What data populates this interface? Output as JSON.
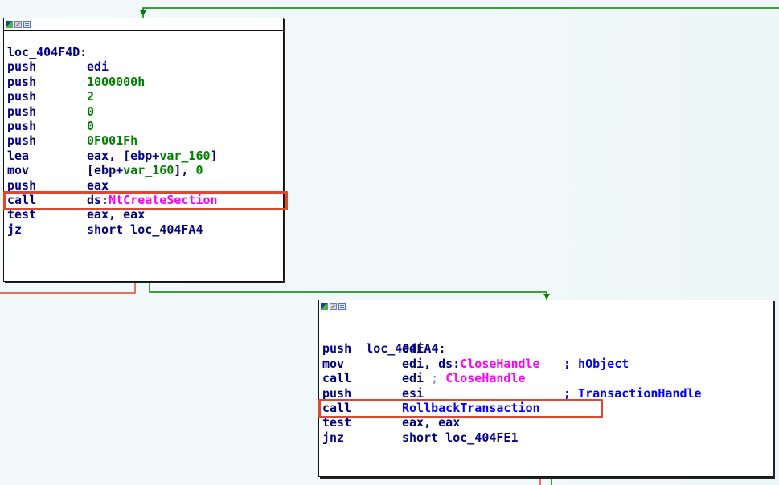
{
  "colors": {
    "background": "#f4fafb",
    "flow_true": "#008000",
    "flow_false": "#e0472f",
    "highlight": "#e0472f",
    "text_default": "#000080",
    "text_number": "#008000",
    "text_import": "#ff00ff",
    "text_comment": "#0000ff"
  },
  "node1": {
    "header_icons": [
      "graph-overview-icon",
      "edit-node-icon",
      "node-window-icon"
    ],
    "label": "loc_404F4D:",
    "lines": [
      {
        "mn": "push",
        "op": [
          {
            "t": "edi",
            "c": "op"
          }
        ]
      },
      {
        "mn": "push",
        "op": [
          {
            "t": "1000000h",
            "c": "num"
          }
        ]
      },
      {
        "mn": "push",
        "op": [
          {
            "t": "2",
            "c": "num"
          }
        ]
      },
      {
        "mn": "push",
        "op": [
          {
            "t": "0",
            "c": "num"
          }
        ]
      },
      {
        "mn": "push",
        "op": [
          {
            "t": "0",
            "c": "num"
          }
        ]
      },
      {
        "mn": "push",
        "op": [
          {
            "t": "0F001Fh",
            "c": "num"
          }
        ]
      },
      {
        "mn": "lea",
        "op": [
          {
            "t": "eax, [ebp+",
            "c": "op"
          },
          {
            "t": "var_160",
            "c": "var"
          },
          {
            "t": "]",
            "c": "op"
          }
        ]
      },
      {
        "mn": "mov",
        "op": [
          {
            "t": "[ebp+",
            "c": "op"
          },
          {
            "t": "var_160",
            "c": "var"
          },
          {
            "t": "], ",
            "c": "op"
          },
          {
            "t": "0",
            "c": "num"
          }
        ]
      },
      {
        "mn": "push",
        "op": [
          {
            "t": "eax",
            "c": "op"
          }
        ]
      },
      {
        "mn": "call",
        "op": [
          {
            "t": "ds:",
            "c": "op"
          },
          {
            "t": "NtCreateSection",
            "c": "imp"
          }
        ]
      },
      {
        "mn": "test",
        "op": [
          {
            "t": "eax, eax",
            "c": "op"
          }
        ]
      },
      {
        "mn": "jz",
        "op": [
          {
            "t": "short loc_404FA4",
            "c": "op"
          }
        ]
      }
    ],
    "highlighted_index": 9
  },
  "node2": {
    "header_icons": [
      "graph-overview-icon",
      "edit-node-icon",
      "node-window-icon"
    ],
    "label": "loc_404FA4:",
    "label_comment": "; hObject",
    "lines": [
      {
        "mn": "push",
        "op": [
          {
            "t": "edi",
            "c": "op"
          }
        ]
      },
      {
        "mn": "mov",
        "op": [
          {
            "t": "edi, ds:",
            "c": "op"
          },
          {
            "t": "CloseHandle",
            "c": "imp"
          }
        ]
      },
      {
        "mn": "call",
        "op": [
          {
            "t": "edi ",
            "c": "op"
          },
          {
            "t": "; ",
            "c": "sep"
          },
          {
            "t": "CloseHandle",
            "c": "imp"
          }
        ]
      },
      {
        "mn": "push",
        "op": [
          {
            "t": "esi",
            "c": "op"
          }
        ],
        "comment": "; TransactionHandle"
      },
      {
        "mn": "call",
        "op": [
          {
            "t": "RollbackTransaction",
            "c": "cmt"
          }
        ]
      },
      {
        "mn": "test",
        "op": [
          {
            "t": "eax, eax",
            "c": "op"
          }
        ]
      },
      {
        "mn": "jnz",
        "op": [
          {
            "t": "short loc_404FE1",
            "c": "op"
          }
        ]
      }
    ],
    "highlighted_index": 4
  }
}
